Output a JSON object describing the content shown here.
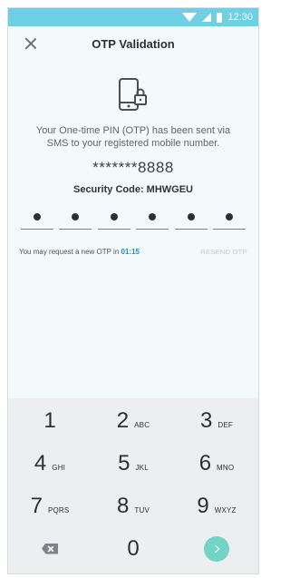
{
  "status_bar": {
    "time": "12:30"
  },
  "header": {
    "title": "OTP Validation"
  },
  "otp": {
    "message": "Your One-time PIN (OTP) has been sent via SMS to your registered mobile number.",
    "masked_number": "*******8888",
    "security_code": "Security Code: MHWGEU",
    "resend_text": "You may request a new OTP in ",
    "timer": "01:15",
    "resend_label": "RESEND OTP"
  },
  "keypad": {
    "rows": [
      [
        {
          "num": "1",
          "letters": ""
        },
        {
          "num": "2",
          "letters": "ABC"
        },
        {
          "num": "3",
          "letters": "DEF"
        }
      ],
      [
        {
          "num": "4",
          "letters": "GHI"
        },
        {
          "num": "5",
          "letters": "JKL"
        },
        {
          "num": "6",
          "letters": "MNO"
        }
      ],
      [
        {
          "num": "7",
          "letters": "PQRS"
        },
        {
          "num": "8",
          "letters": "TUV"
        },
        {
          "num": "9",
          "letters": "WXYZ"
        }
      ]
    ],
    "zero": "0"
  },
  "colors": {
    "accent": "#6fd0e4",
    "enter": "#73d3c5",
    "timer": "#1e8dd1"
  }
}
